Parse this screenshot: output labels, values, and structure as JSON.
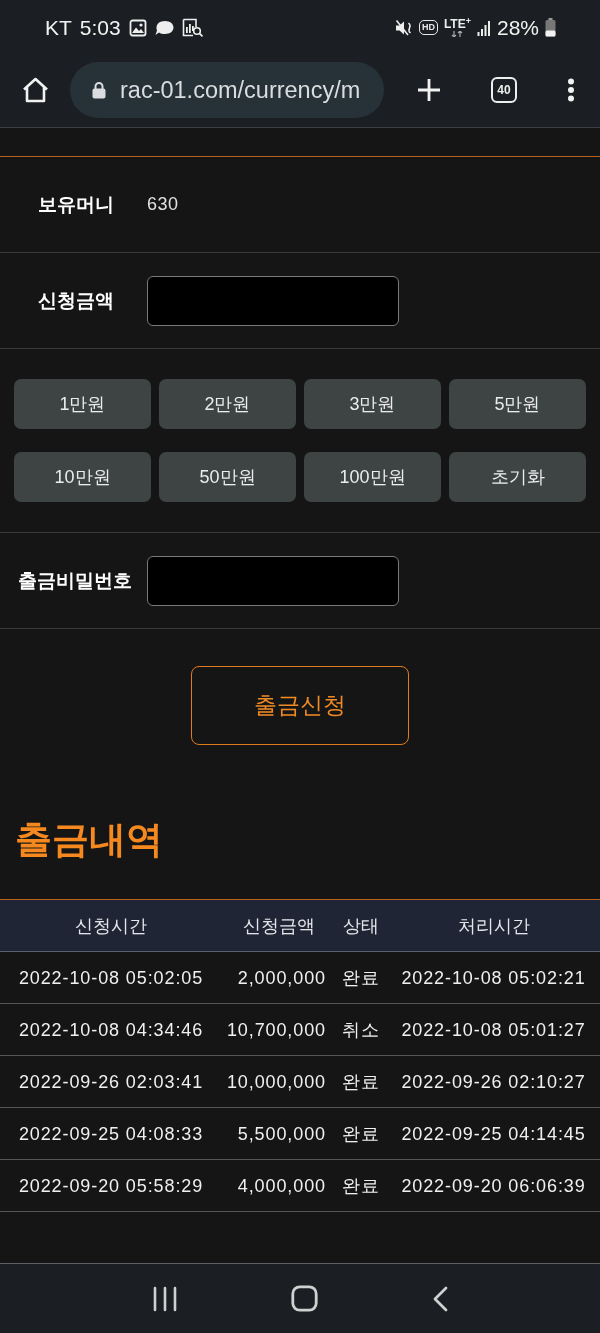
{
  "status_bar": {
    "carrier": "KT",
    "time": "5:03",
    "hd": "HD",
    "network": "LTE$^{+}$",
    "battery": "28%"
  },
  "browser": {
    "url": "rac-01.com/currency/m",
    "tab_count": "40"
  },
  "form": {
    "balance": {
      "label": "보유머니",
      "value": "630"
    },
    "amount": {
      "label": "신청금액"
    },
    "quick_amounts": [
      "1만원",
      "2만원",
      "3만원",
      "5만원",
      "10만원",
      "50만원",
      "100만원",
      "초기화"
    ],
    "password": {
      "label": "출금비밀번호"
    },
    "submit": "출금신청"
  },
  "history": {
    "title": "출금내역",
    "columns": [
      "신청시간",
      "신청금액",
      "상태",
      "처리시간"
    ],
    "rows": [
      [
        "2022-10-08 05:02:05",
        "2,000,000",
        "완료",
        "2022-10-08 05:02:21"
      ],
      [
        "2022-10-08 04:34:46",
        "10,700,000",
        "취소",
        "2022-10-08 05:01:27"
      ],
      [
        "2022-09-26 02:03:41",
        "10,000,000",
        "완료",
        "2022-09-26 02:10:27"
      ],
      [
        "2022-09-25 04:08:33",
        "5,500,000",
        "완료",
        "2022-09-25 04:14:45"
      ],
      [
        "2022-09-20 05:58:29",
        "4,000,000",
        "완료",
        "2022-09-20 06:06:39"
      ]
    ]
  }
}
